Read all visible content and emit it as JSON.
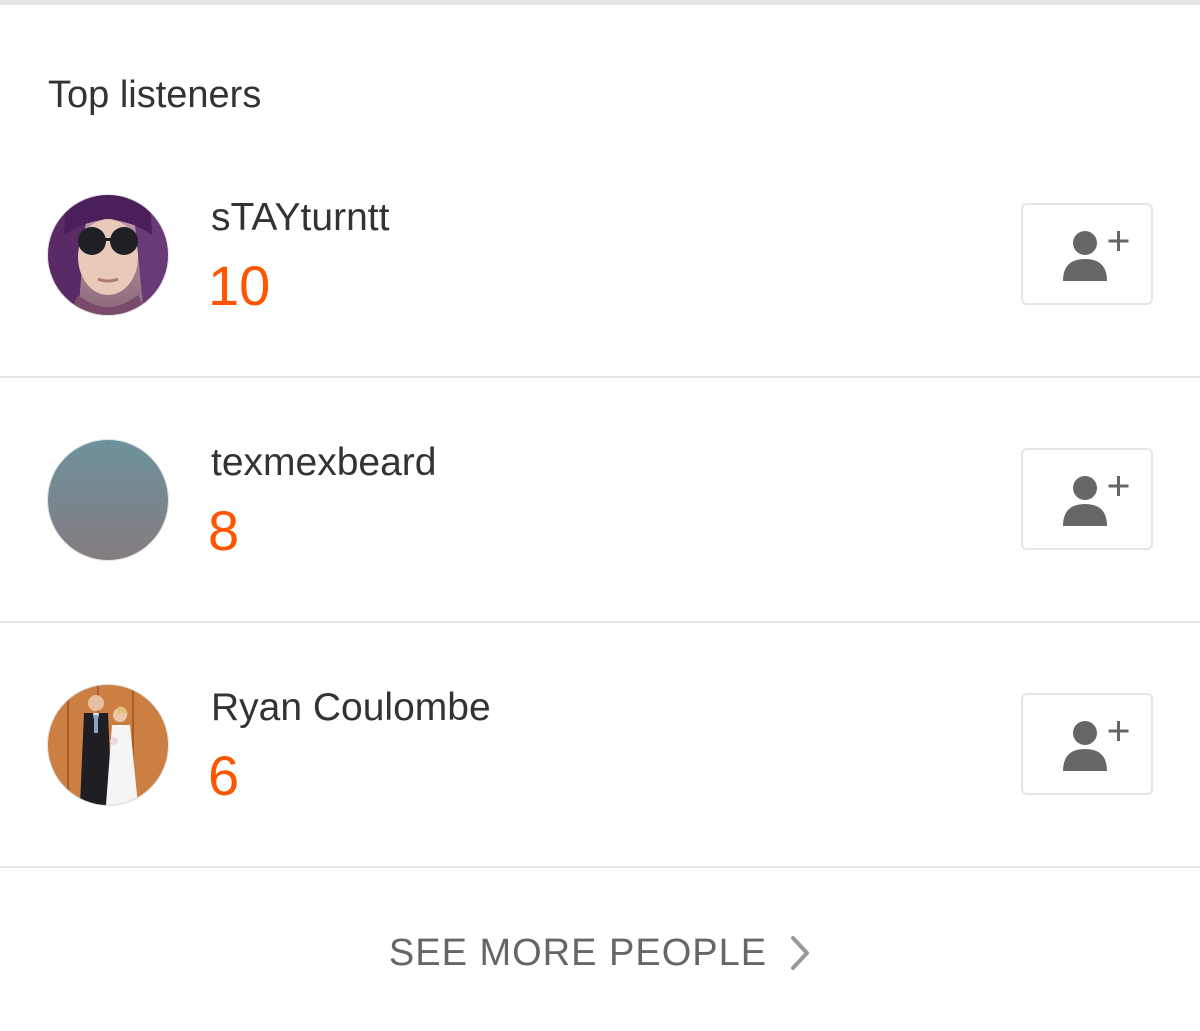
{
  "section": {
    "title": "Top listeners"
  },
  "listeners": [
    {
      "username": "sTAYturntt",
      "count": "10",
      "avatar_icon": "avatar-photo-woman-sunglasses",
      "follow_icon": "add-user-icon"
    },
    {
      "username": "texmexbeard",
      "count": "8",
      "avatar_icon": "avatar-default-gradient",
      "follow_icon": "add-user-icon"
    },
    {
      "username": "Ryan Coulombe",
      "count": "6",
      "avatar_icon": "avatar-photo-couple",
      "follow_icon": "add-user-icon"
    }
  ],
  "footer": {
    "see_more_label": "SEE MORE PEOPLE",
    "chevron_icon": "chevron-right-icon"
  },
  "colors": {
    "accent": "#ff5500",
    "text": "#333333",
    "muted": "#666666",
    "divider": "#e5e5e5",
    "icon": "#666666"
  }
}
